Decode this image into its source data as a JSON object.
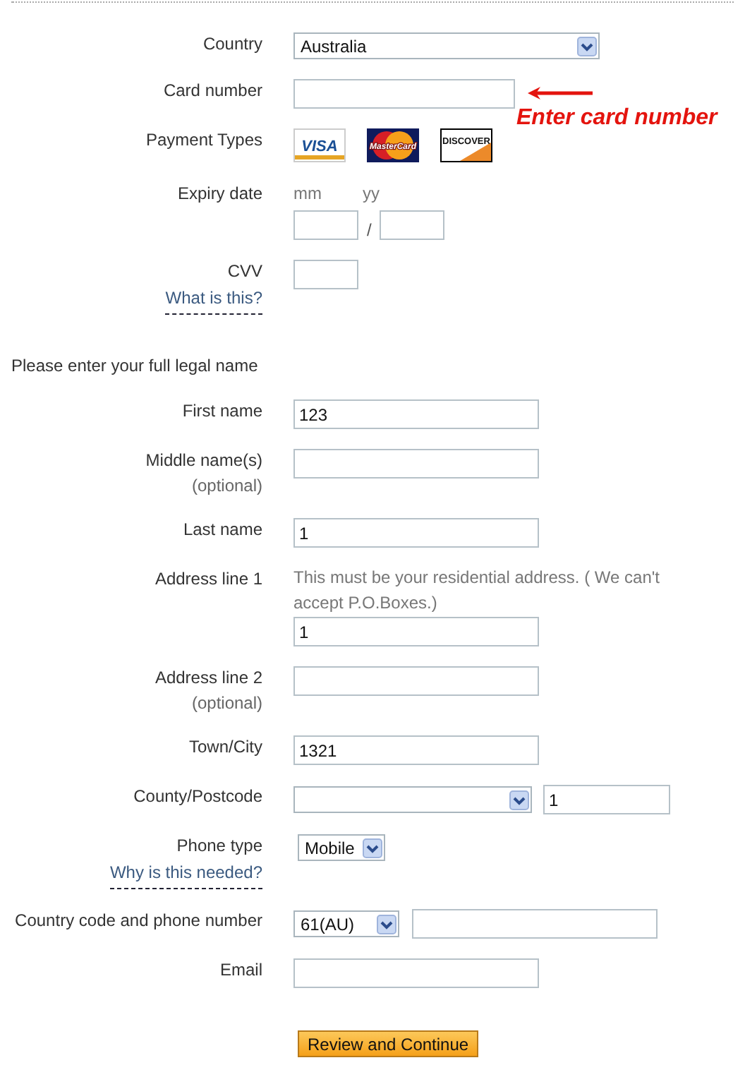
{
  "rows": [
    {
      "kind": "select",
      "label": "Country",
      "value": "Australia"
    },
    {
      "kind": "card-number",
      "label": "Card number",
      "annotation": "Enter card number"
    },
    {
      "kind": "cards",
      "label": "Payment Types",
      "cards": [
        {
          "kind": "visa",
          "text": "VISA"
        },
        {
          "kind": "mastercard",
          "text": "MasterCard"
        },
        {
          "kind": "discover",
          "text": "DISCOVER"
        }
      ]
    },
    {
      "kind": "expiry",
      "label": "Expiry date",
      "month_caption": "mm",
      "year_caption": "yy",
      "separator": "/"
    },
    {
      "kind": "cvv",
      "label": "CVV",
      "help_link": "What is this?"
    },
    {
      "kind": "heading",
      "text": "Please enter your full legal name"
    },
    {
      "kind": "text",
      "label": "First name",
      "value": "123"
    },
    {
      "kind": "text",
      "label": "Middle name(s)",
      "note": "(optional)"
    },
    {
      "kind": "text",
      "label": "Last name",
      "value": "1"
    },
    {
      "kind": "text",
      "label": "Address line 1",
      "hint": "This must be your residential address. ( We can't accept P.O.Boxes.)",
      "value": "1"
    },
    {
      "kind": "text",
      "label": "Address line 2",
      "note": "(optional)"
    },
    {
      "kind": "text",
      "label": "Town/City",
      "value": "1321"
    },
    {
      "kind": "county",
      "label": "County/Postcode",
      "postcode": "1"
    },
    {
      "kind": "phone-type",
      "label": "Phone type",
      "value": "Mobile",
      "help_link": "Why is this needed?"
    },
    {
      "kind": "phone",
      "label": "Country code and phone number",
      "code": "61(AU)"
    },
    {
      "kind": "text",
      "label": "Email"
    }
  ],
  "submit": "Review and Continue"
}
